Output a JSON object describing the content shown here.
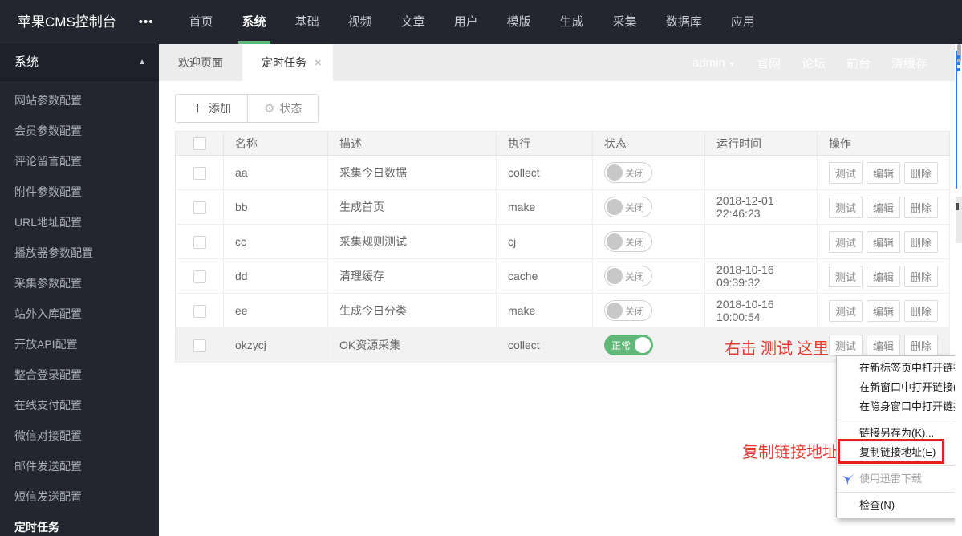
{
  "app": {
    "title": "苹果CMS控制台",
    "more_glyph": "•••"
  },
  "topnav": {
    "items": [
      "首页",
      "系统",
      "基础",
      "视频",
      "文章",
      "用户",
      "模版",
      "生成",
      "采集",
      "数据库",
      "应用"
    ],
    "active": "系统"
  },
  "sidebar": {
    "header": "系统",
    "collapse_glyph": "▲",
    "items": [
      "网站参数配置",
      "会员参数配置",
      "评论留言配置",
      "附件参数配置",
      "URL地址配置",
      "播放器参数配置",
      "采集参数配置",
      "站外入库配置",
      "开放API配置",
      "整合登录配置",
      "在线支付配置",
      "微信对接配置",
      "邮件发送配置",
      "短信发送配置",
      "定时任务"
    ],
    "active": "定时任务"
  },
  "tabbar": {
    "tabs": [
      {
        "label": "欢迎页面",
        "active": false
      },
      {
        "label": "定时任务",
        "active": true,
        "close_glyph": "×"
      }
    ]
  },
  "userbar": {
    "username": "admin",
    "caret_glyph": "▼",
    "links": [
      "官网",
      "论坛",
      "前台",
      "清缓存"
    ]
  },
  "toolbar": {
    "add_icon_glyph": "＋",
    "add_label": "添加",
    "status_icon_glyph": "⚙",
    "status_label": "状态"
  },
  "table": {
    "headers": [
      "名称",
      "描述",
      "执行",
      "状态",
      "运行时间",
      "操作"
    ],
    "action_labels": [
      "测试",
      "编辑",
      "删除"
    ],
    "action_names": [
      "test-button",
      "edit-button",
      "delete-button"
    ],
    "rows": [
      {
        "name": "aa",
        "desc": "采集今日数据",
        "exec": "collect",
        "status": "off",
        "status_label": "关闭",
        "run_time": "",
        "highlighted": false
      },
      {
        "name": "bb",
        "desc": "生成首页",
        "exec": "make",
        "status": "off",
        "status_label": "关闭",
        "run_time": "2018-12-01 22:46:23",
        "highlighted": false
      },
      {
        "name": "cc",
        "desc": "采集规则测试",
        "exec": "cj",
        "status": "off",
        "status_label": "关闭",
        "run_time": "",
        "highlighted": false
      },
      {
        "name": "dd",
        "desc": "清理缓存",
        "exec": "cache",
        "status": "off",
        "status_label": "关闭",
        "run_time": "2018-10-16 09:39:32",
        "highlighted": false
      },
      {
        "name": "ee",
        "desc": "生成今日分类",
        "exec": "make",
        "status": "off",
        "status_label": "关闭",
        "run_time": "2018-10-16 10:00:54",
        "highlighted": false
      },
      {
        "name": "okzycj",
        "desc": "OK资源采集",
        "exec": "collect",
        "status": "on",
        "status_label": "正常",
        "run_time": "",
        "highlighted": true
      }
    ]
  },
  "annotations": {
    "right_click_hint": "右击 测试 这里",
    "copy_link_hint": "复制链接地址",
    "color": "#e53a30"
  },
  "context_menu": {
    "items": [
      {
        "label": "在新标签页中打开链接(T)"
      },
      {
        "label": "在新窗口中打开链接(W)"
      },
      {
        "label": "在隐身窗口中打开链接(G)"
      },
      {
        "separator": true
      },
      {
        "label": "链接另存为(K)..."
      },
      {
        "label": "复制链接地址(E)",
        "highlighted": true
      },
      {
        "separator": true
      },
      {
        "label": "使用迅雷下载",
        "icon": "xunlei-bird-icon",
        "disabled": true
      },
      {
        "separator": true
      },
      {
        "label": "检查(N)"
      }
    ]
  },
  "colors": {
    "topbar_bg": "#23262e",
    "accent_green": "#5fb878",
    "toggle_off_gray": "#c8c8c8",
    "annotation_red": "#e53a30",
    "highlight_box_red": "#e5231b",
    "xunlei_blue": "#5b7ff0"
  }
}
